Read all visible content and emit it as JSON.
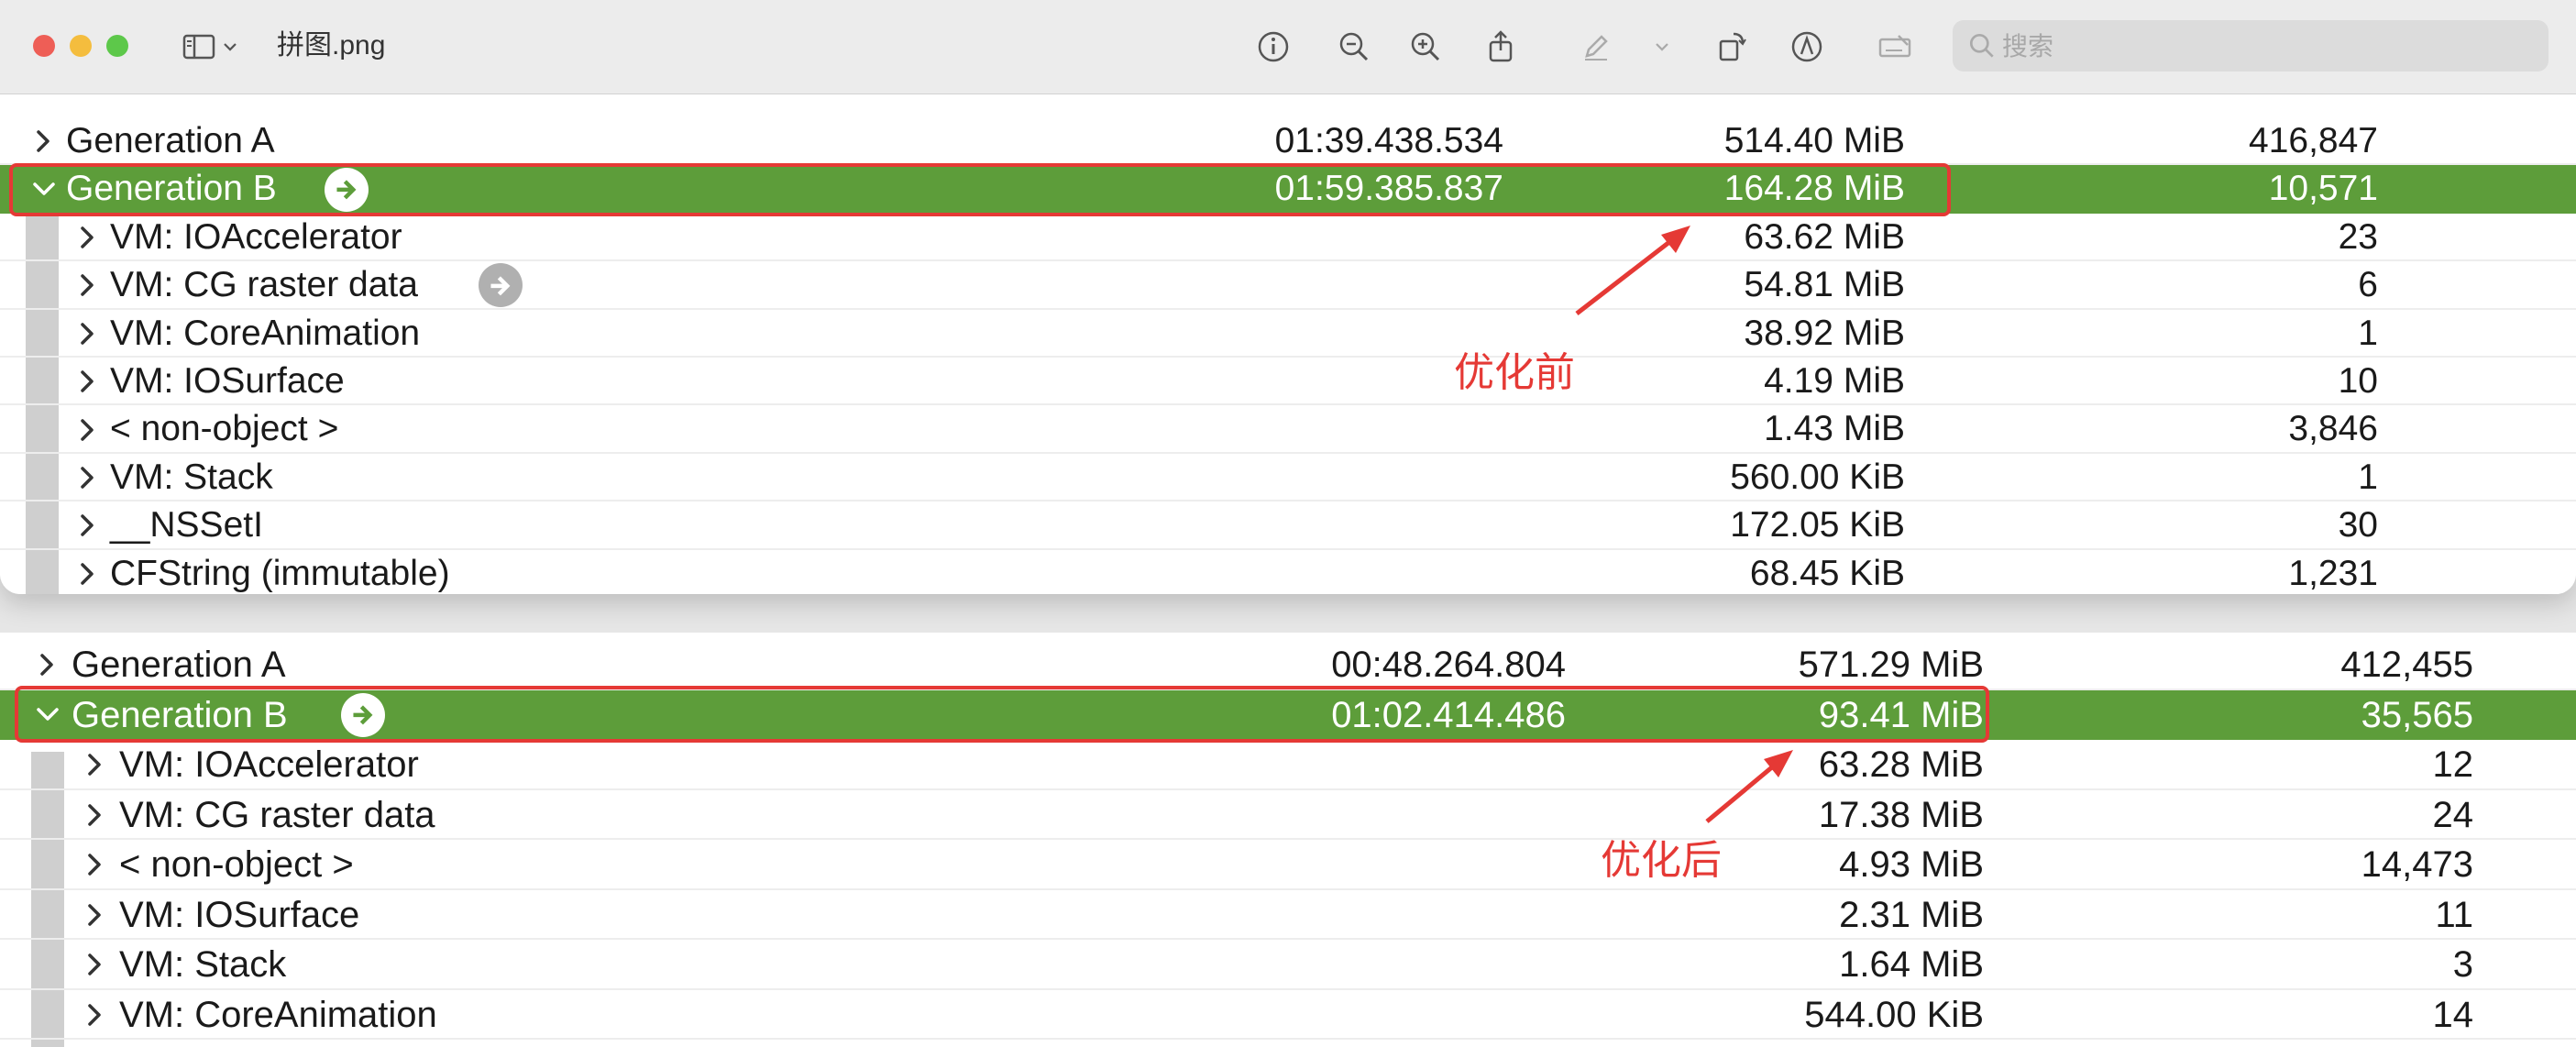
{
  "window": {
    "title": "拼图.png",
    "search_placeholder": "搜索",
    "icons": [
      "sidebar-icon",
      "chevron-down-icon",
      "info-icon",
      "zoom-out-icon",
      "zoom-in-icon",
      "share-icon",
      "markup-pen-icon",
      "chevron-down-icon",
      "rotate-icon",
      "annotate-icon",
      "signature-icon",
      "search-icon"
    ]
  },
  "colors": {
    "selected_row": "#5d9d3a",
    "annotation": "#e53935"
  },
  "top_table": {
    "rows": [
      {
        "name": "Generation A",
        "time": "01:39.438.534",
        "size": "514.40 MiB",
        "count": "416,847"
      },
      {
        "name": "Generation B",
        "time": "01:59.385.837",
        "size": "164.28 MiB",
        "count": "10,571"
      },
      {
        "name": "VM: IOAccelerator",
        "size": "63.62 MiB",
        "count": "23"
      },
      {
        "name": "VM: CG raster data",
        "size": "54.81 MiB",
        "count": "6"
      },
      {
        "name": "VM: CoreAnimation",
        "size": "38.92 MiB",
        "count": "1"
      },
      {
        "name": "VM: IOSurface",
        "size": "4.19 MiB",
        "count": "10"
      },
      {
        "name": "< non-object >",
        "size": "1.43 MiB",
        "count": "3,846"
      },
      {
        "name": "VM: Stack",
        "size": "560.00 KiB",
        "count": "1"
      },
      {
        "name": "__NSSetI",
        "size": "172.05 KiB",
        "count": "30"
      },
      {
        "name": "CFString (immutable)",
        "size": "68.45 KiB",
        "count": "1,231"
      }
    ],
    "annotation": "优化前"
  },
  "bottom_table": {
    "rows": [
      {
        "name": "Generation A",
        "time": "00:48.264.804",
        "size": "571.29 MiB",
        "count": "412,455"
      },
      {
        "name": "Generation B",
        "time": "01:02.414.486",
        "size": "93.41 MiB",
        "count": "35,565"
      },
      {
        "name": "VM: IOAccelerator",
        "size": "63.28 MiB",
        "count": "12"
      },
      {
        "name": "VM: CG raster data",
        "size": "17.38 MiB",
        "count": "24"
      },
      {
        "name": "< non-object >",
        "size": "4.93 MiB",
        "count": "14,473"
      },
      {
        "name": "VM: IOSurface",
        "size": "2.31 MiB",
        "count": "11"
      },
      {
        "name": "VM: Stack",
        "size": "1.64 MiB",
        "count": "3"
      },
      {
        "name": "VM: CoreAnimation",
        "size": "544.00 KiB",
        "count": "14"
      }
    ],
    "annotation": "优化后"
  }
}
